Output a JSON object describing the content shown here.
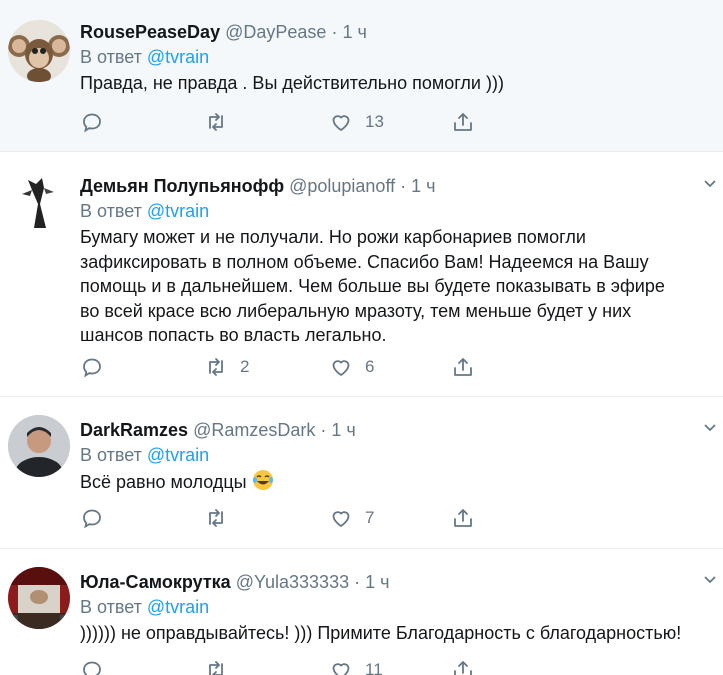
{
  "tweets": [
    {
      "name": "RousePeaseDay",
      "handle": "@DayPease",
      "dot": "·",
      "time": "1 ч",
      "reply_prefix": "В ответ",
      "reply_to": "@tvrain",
      "text": "Правда, не правда . Вы действительно помогли )))",
      "reply_count": "",
      "retweet_count": "",
      "like_count": "13",
      "avatar_icon": "cheburashka-avatar"
    },
    {
      "name": "Демьян Полупьянофф",
      "handle": "@polupianoff",
      "dot": "·",
      "time": "1 ч",
      "reply_prefix": "В ответ",
      "reply_to": "@tvrain",
      "text": "Бумагу может и не получали. Но рожи карбонариев помогли зафиксировать в полном объеме. Спасибо Вам! Надеемся на Вашу помощь и в дальнейшем. Чем больше вы будете показывать в эфире во всей красе всю либеральную мразоту, тем меньше будет у них шансов попасть во власть легально.",
      "reply_count": "",
      "retweet_count": "2",
      "like_count": "6",
      "avatar_icon": "sculpture-avatar"
    },
    {
      "name": "DarkRamzes",
      "handle": "@RamzesDark",
      "dot": "·",
      "time": "1 ч",
      "reply_prefix": "В ответ",
      "reply_to": "@tvrain",
      "text": "Всё равно молодцы",
      "reply_count": "",
      "retweet_count": "",
      "like_count": "7",
      "avatar_icon": "person-avatar"
    },
    {
      "name": "Юла-Самокрутка",
      "handle": "@Yula333333",
      "dot": "·",
      "time": "1 ч",
      "reply_prefix": "В ответ",
      "reply_to": "@tvrain",
      "text": ")))))) не оправдывайтесь! ))) Примите Благодарность с благодарностью!",
      "reply_count": "",
      "retweet_count": "",
      "like_count": "11",
      "avatar_icon": "stage-avatar"
    }
  ],
  "colors": {
    "link": "#1da1f2",
    "secondary_text": "#657786",
    "primary_text": "#14171a",
    "highlight_bg": "#f5f8fa",
    "divider": "#e6ecf0"
  }
}
